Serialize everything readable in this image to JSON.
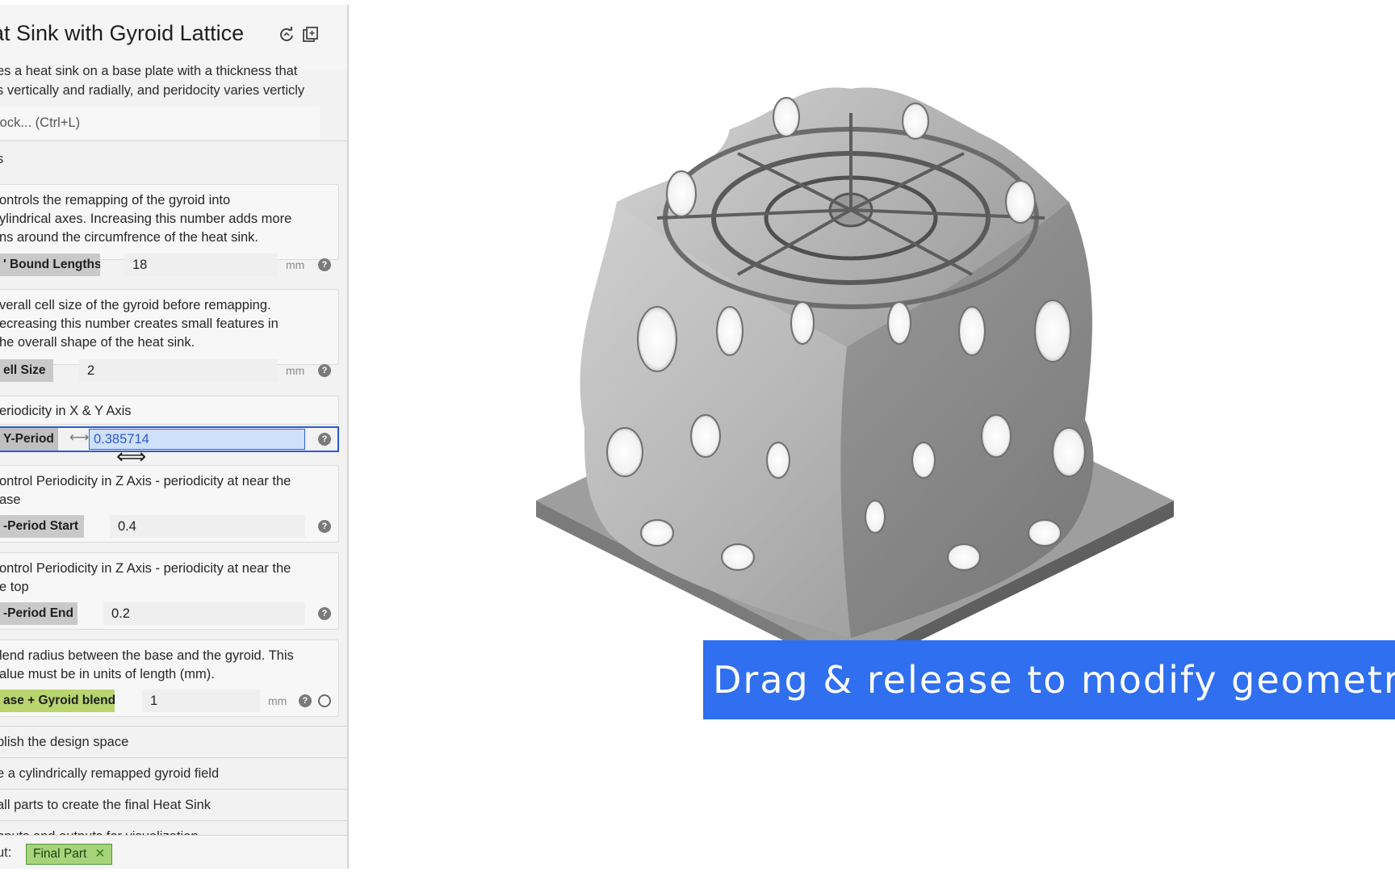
{
  "panel": {
    "title": "at Sink with Gyroid Lattice",
    "description_lines": [
      "es a heat sink on a base plate with a thickness that",
      "s vertically and radially, and peridocity varies verticly"
    ],
    "search_placeholder": "lock... (Ctrl+L)",
    "section_label": "s",
    "cards": [
      {
        "text": "ontrols the remapping of the gyroid into ylindrical axes. Increasing this number adds more ns around the circumfrence of the heat sink.",
        "text_lines": [
          "ontrols the remapping of the gyroid into",
          "ylindrical axes. Increasing this number adds more",
          "ns around the circumfrence of the heat sink."
        ],
        "param_name": "' Bound Lengths",
        "value": "18",
        "unit": "mm"
      },
      {
        "text_lines": [
          "verall cell size of the gyroid before remapping.",
          "ecreasing this number creates small features in",
          "he overall shape of the heat sink."
        ],
        "param_name": "ell Size",
        "value": "2",
        "unit": "mm"
      },
      {
        "text_lines": [
          "eriodicity in X & Y Axis"
        ],
        "param_name": "Y-Period",
        "value": "0.385714",
        "unit": ""
      },
      {
        "text_lines": [
          "ontrol Periodicity in Z Axis - periodicity at near the",
          "ase"
        ],
        "param_name": "-Period Start",
        "value": "0.4",
        "unit": ""
      },
      {
        "text_lines": [
          "ontrol Periodicity in Z Axis - periodicity at near the",
          "e top"
        ],
        "param_name": "-Period End",
        "value": "0.2",
        "unit": ""
      },
      {
        "text_lines": [
          "lend radius between the base and the gyroid. This",
          "alue must be in units of length (mm)."
        ],
        "param_name": "ase + Gyroid blend",
        "value": "1",
        "unit": "mm"
      }
    ],
    "list_rows": [
      "blish the design space",
      "e a cylindrically remapped gyroid field",
      "all parts to create the final Heat Sink",
      "nputs and outputs for visualization"
    ],
    "output_label": "ut:",
    "output_tag": "Final Part",
    "help_glyph": "?"
  },
  "viewport": {
    "caption": "Drag & release to modify geometry",
    "caption_color": "#2f6ff0"
  },
  "icons": {
    "refresh": "refresh-icon",
    "copy": "copy-icon",
    "resize_cursor": "⟺"
  },
  "colors": {
    "active_outline": "#2a5ad6",
    "blend_highlight": "#b9d56f",
    "output_tag": "#a7d37a"
  }
}
